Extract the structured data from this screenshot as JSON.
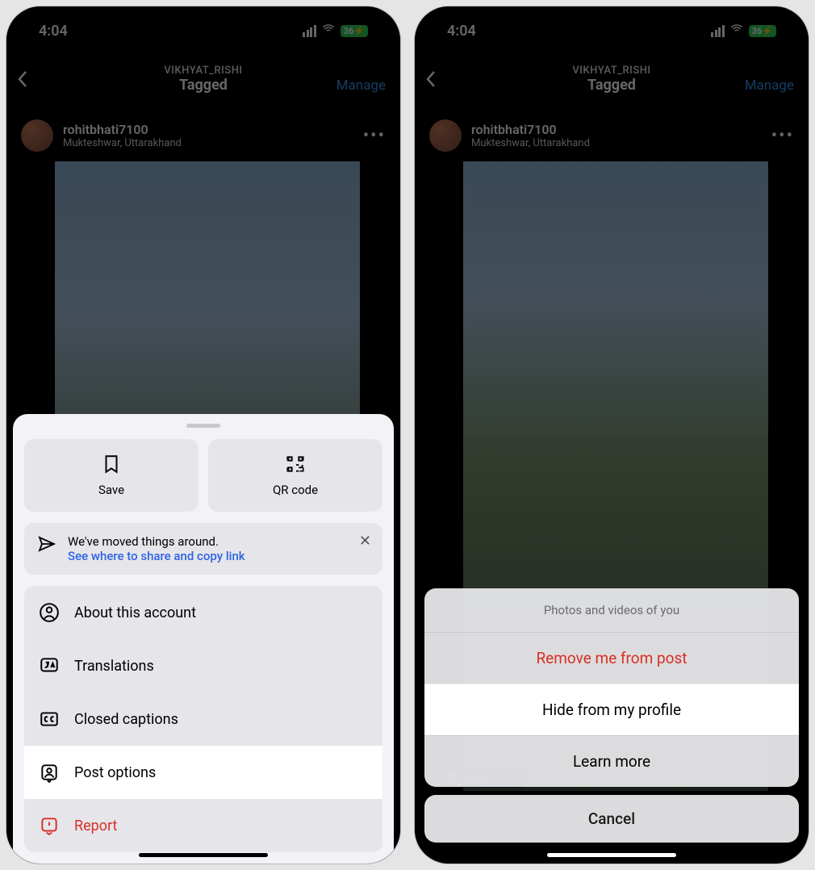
{
  "status": {
    "time": "4:04",
    "battery": "36"
  },
  "header": {
    "subtitle": "VIKHYAT_RISHI",
    "title": "Tagged",
    "manage": "Manage"
  },
  "post": {
    "username": "rohitbhati7100",
    "location": "Mukteshwar, Uttarakhand"
  },
  "sheet": {
    "save": "Save",
    "qr": "QR code",
    "notice_line1": "We've moved things around.",
    "notice_line2": "See where to share and copy link",
    "items": {
      "about": "About this account",
      "translations": "Translations",
      "captions": "Closed captions",
      "post_options": "Post options",
      "report": "Report"
    }
  },
  "alert": {
    "header": "Photos and videos of you",
    "remove": "Remove me from post",
    "hide": "Hide from my profile",
    "learn": "Learn more",
    "cancel": "Cancel"
  },
  "tag": {
    "label": "kitsa_vista"
  }
}
